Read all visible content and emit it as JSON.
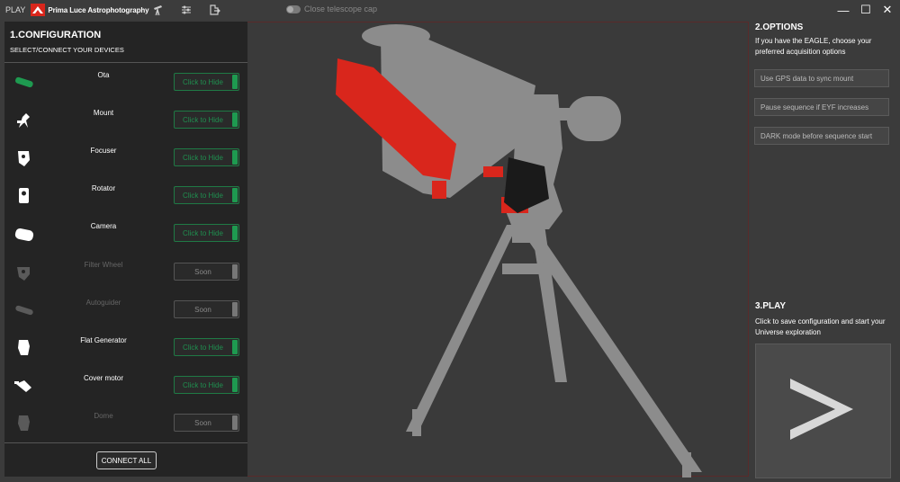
{
  "titlebar": {
    "play": "PLAY",
    "brand": "Prima Luce Astrophotography",
    "cap_label": "Close telescope cap",
    "minimize": "—",
    "maximize": "☐",
    "close": "✕"
  },
  "config": {
    "title": "1.CONFIGURATION",
    "subtitle": "SELECT/CONNECT YOUR DEVICES",
    "devices": [
      {
        "label": "Ota",
        "button": "Click to Hide",
        "icon": "ota-icon"
      },
      {
        "label": "Mount",
        "button": "Click to Hide",
        "icon": "mount-icon"
      },
      {
        "label": "Focuser",
        "button": "Click to Hide",
        "icon": "focuser-icon"
      },
      {
        "label": "Rotator",
        "button": "Click to Hide",
        "icon": "rotator-icon"
      },
      {
        "label": "Camera",
        "button": "Click to Hide",
        "icon": "camera-icon"
      },
      {
        "label": "Filter Wheel",
        "button": "Soon",
        "icon": "filter-wheel-icon"
      },
      {
        "label": "Autoguider",
        "button": "Soon",
        "icon": "autoguider-icon"
      },
      {
        "label": "Flat Generator",
        "button": "Click to Hide",
        "icon": "flat-generator-icon"
      },
      {
        "label": "Cover motor",
        "button": "Click to Hide",
        "icon": "cover-motor-icon"
      },
      {
        "label": "Dome",
        "button": "Soon",
        "icon": "dome-icon"
      }
    ],
    "connect_all": "CONNECT ALL"
  },
  "options": {
    "title": "2.OPTIONS",
    "text": "If you have the EAGLE, choose your preferred acquisition options",
    "buttons": [
      "Use GPS data to sync mount",
      "Pause sequence if EYF increases",
      "DARK mode before sequence start"
    ]
  },
  "play": {
    "title": "3.PLAY",
    "text": "Click to save configuration and start your Universe exploration",
    "symbol": ">"
  },
  "colors": {
    "accent_green": "#1e9a50",
    "accent_red": "#d9261c",
    "panel": "#242424",
    "background": "#3b3b3b"
  }
}
